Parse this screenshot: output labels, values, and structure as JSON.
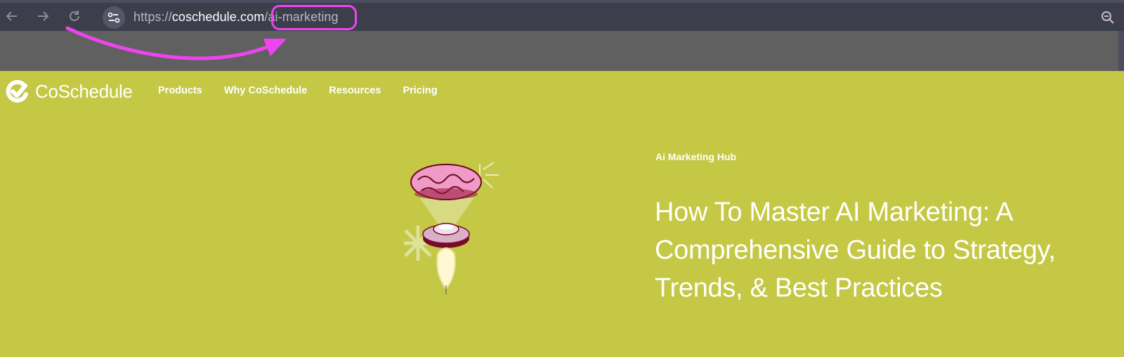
{
  "browser": {
    "back_icon": "arrow-left-icon",
    "forward_icon": "arrow-right-icon",
    "reload_icon": "reload-icon",
    "site_info_icon": "tune-icon",
    "url_scheme": "https://",
    "url_host": "coschedule.com",
    "url_path": "/ai-marketing",
    "zoom_icon": "zoom-out-icon"
  },
  "annotation": {
    "highlight_color": "#ee44ee",
    "arrow_color": "#ee44ee"
  },
  "site": {
    "brand_name": "CoSchedule",
    "logo_icon": "check-circle-icon",
    "background_color": "#c4c844",
    "nav": [
      {
        "label": "Products"
      },
      {
        "label": "Why CoSchedule"
      },
      {
        "label": "Resources"
      },
      {
        "label": "Pricing"
      }
    ]
  },
  "hero": {
    "eyebrow": "Ai Marketing Hub",
    "title": "How To Master AI Marketing: A Comprehensive Guide to Strategy, Trends, & Best Practices",
    "illustration": "brain-rocket-illustration"
  }
}
